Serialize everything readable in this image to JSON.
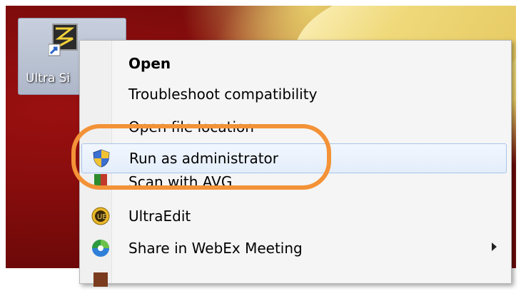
{
  "desktop": {
    "shortcut": {
      "label": "Ultra Si",
      "icon": "ultra-shortcut-icon"
    }
  },
  "context_menu": {
    "items": [
      {
        "label": "Open",
        "bold": true
      },
      {
        "label": "Troubleshoot compatibility"
      },
      {
        "label": "Open file location"
      },
      {
        "label": "Run as administrator",
        "icon": "uac-shield-icon",
        "highlighted": true
      },
      {
        "label": "Scan with AVG",
        "icon": "avg-icon"
      },
      {
        "label": "UltraEdit",
        "icon": "ultraedit-icon"
      },
      {
        "label": "Share in WebEx Meeting",
        "icon": "webex-icon",
        "submenu": true
      }
    ]
  },
  "annotation": {
    "color": "#f39237",
    "target": "Run as administrator"
  },
  "colors": {
    "highlight_border": "#a8c3ea",
    "menu_bg": "#f5f5f5"
  }
}
